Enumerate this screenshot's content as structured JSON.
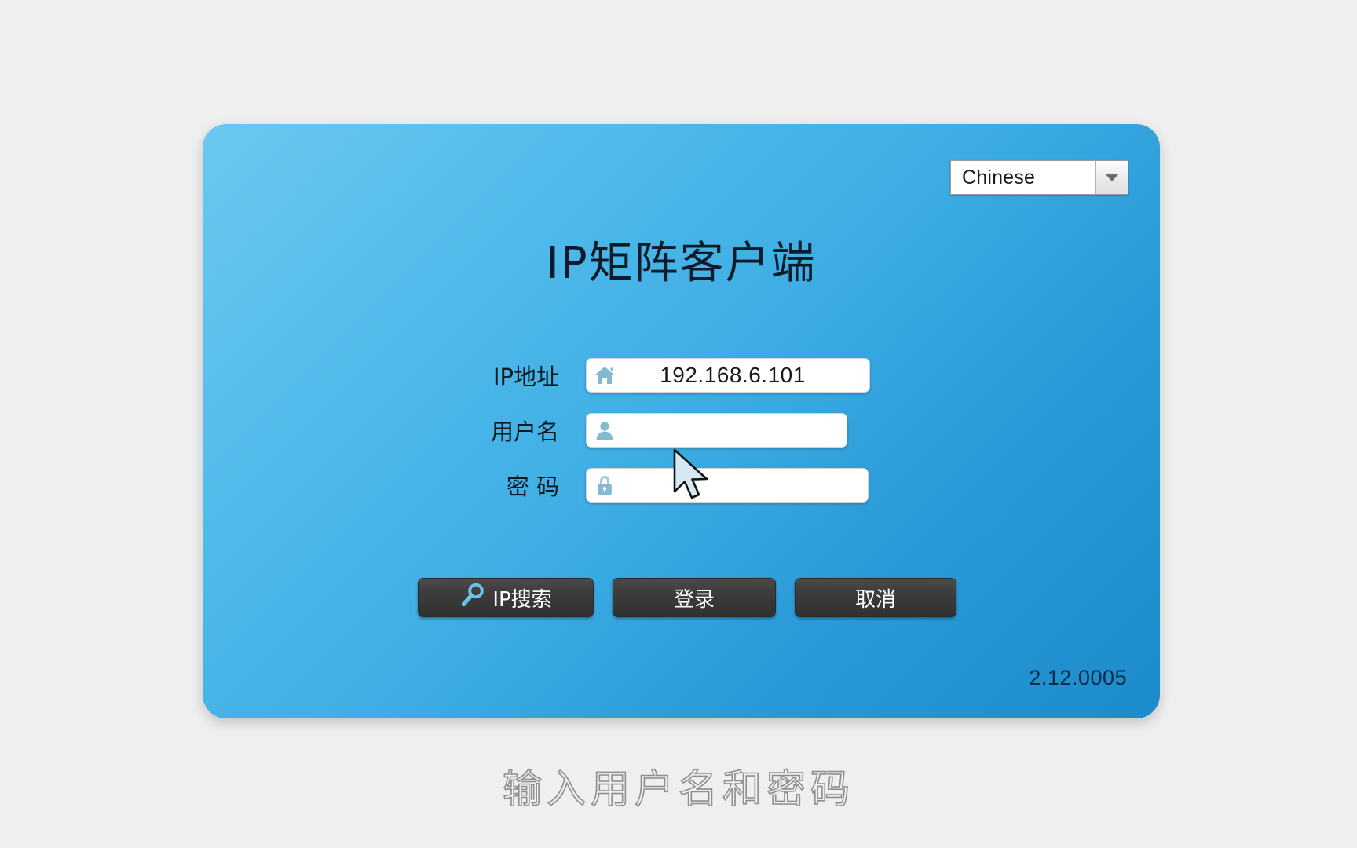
{
  "app": {
    "title": "IP矩阵客户端",
    "version": "2.12.0005"
  },
  "language": {
    "selected": "Chinese",
    "arrow_icon": "chevron-down-icon"
  },
  "form": {
    "rows": [
      {
        "label": "IP地址",
        "icon": "home-icon",
        "value": "192.168.6.101",
        "placeholder": ""
      },
      {
        "label": "用户名",
        "icon": "user-icon",
        "value": "",
        "placeholder": ""
      },
      {
        "label": "密 码",
        "icon": "lock-icon",
        "value": "",
        "placeholder": ""
      }
    ]
  },
  "buttons": {
    "search": "IP搜索",
    "search_icon": "magnifier-icon",
    "login": "登录",
    "cancel": "取消"
  },
  "caption": "输入用户名和密码",
  "colors": {
    "panel_light": "#6cc8f0",
    "panel_dark": "#1b8bcb",
    "button_dark": "#3b3b3b",
    "icon_blue": "#7fb8d4",
    "page_background": "#efefef",
    "title_text": "#0d1b2a"
  },
  "cursor": {
    "icon": "arrow-pointer-cursor"
  }
}
